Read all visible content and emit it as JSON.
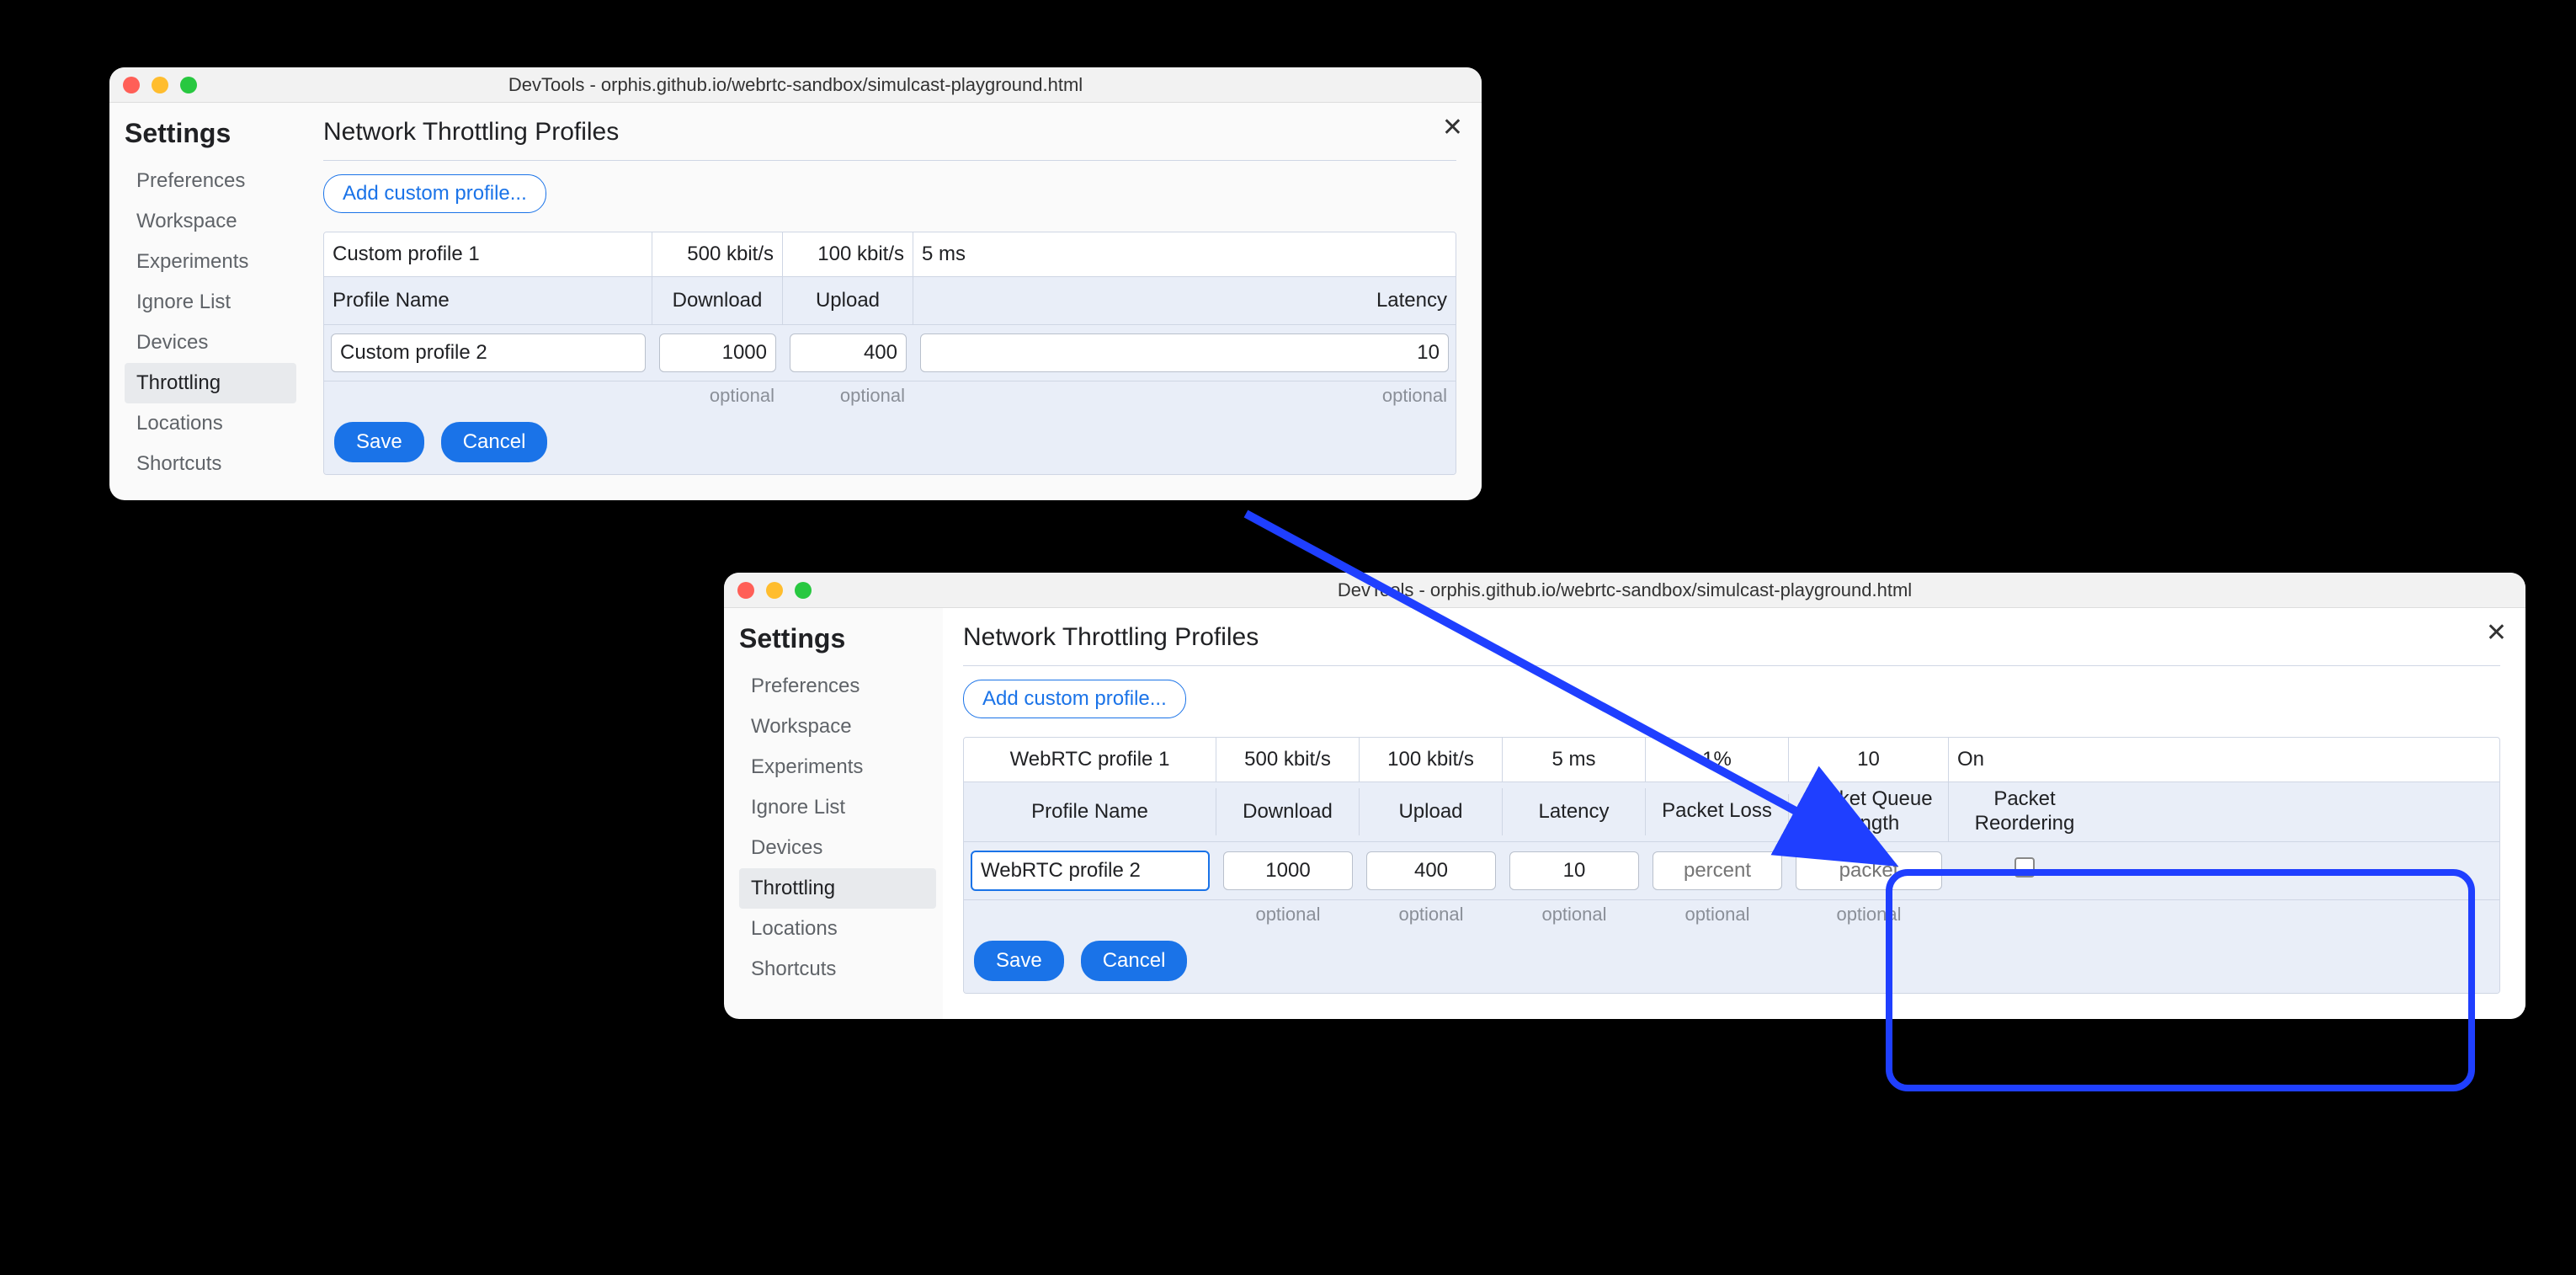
{
  "window1": {
    "title": "DevTools - orphis.github.io/webrtc-sandbox/simulcast-playground.html",
    "sidebar": {
      "heading": "Settings",
      "items": [
        "Preferences",
        "Workspace",
        "Experiments",
        "Ignore List",
        "Devices",
        "Throttling",
        "Locations",
        "Shortcuts"
      ],
      "active_index": 5
    },
    "main": {
      "close_label": "✕",
      "heading": "Network Throttling Profiles",
      "add_button": "Add custom profile...",
      "headers": {
        "name": "Profile Name",
        "download": "Download",
        "upload": "Upload",
        "latency": "Latency"
      },
      "existing_row": {
        "name": "Custom profile 1",
        "download": "500 kbit/s",
        "upload": "100 kbit/s",
        "latency": "5 ms"
      },
      "editor": {
        "name": "Custom profile 2",
        "download": "1000",
        "upload": "400",
        "latency": "10"
      },
      "hints": {
        "download": "optional",
        "upload": "optional",
        "latency": "optional"
      },
      "save": "Save",
      "cancel": "Cancel"
    }
  },
  "window2": {
    "title": "DevTools - orphis.github.io/webrtc-sandbox/simulcast-playground.html",
    "sidebar": {
      "heading": "Settings",
      "items": [
        "Preferences",
        "Workspace",
        "Experiments",
        "Ignore List",
        "Devices",
        "Throttling",
        "Locations",
        "Shortcuts"
      ],
      "active_index": 5
    },
    "main": {
      "close_label": "✕",
      "heading": "Network Throttling Profiles",
      "add_button": "Add custom profile...",
      "headers": {
        "name": "Profile Name",
        "download": "Download",
        "upload": "Upload",
        "latency": "Latency",
        "packet_loss": "Packet Loss",
        "packet_queue": "Packet Queue Length",
        "packet_reorder": "Packet Reordering"
      },
      "existing_row": {
        "name": "WebRTC profile 1",
        "download": "500 kbit/s",
        "upload": "100 kbit/s",
        "latency": "5 ms",
        "packet_loss": "1%",
        "packet_queue": "10",
        "packet_reorder": "On"
      },
      "editor": {
        "name": "WebRTC profile 2",
        "download": "1000",
        "upload": "400",
        "latency": "10",
        "packet_loss_placeholder": "percent",
        "packet_queue_placeholder": "packet",
        "packet_reorder_checked": false
      },
      "hints": {
        "download": "optional",
        "upload": "optional",
        "latency": "optional",
        "packet_loss": "optional",
        "packet_queue": "optional"
      },
      "save": "Save",
      "cancel": "Cancel"
    }
  }
}
